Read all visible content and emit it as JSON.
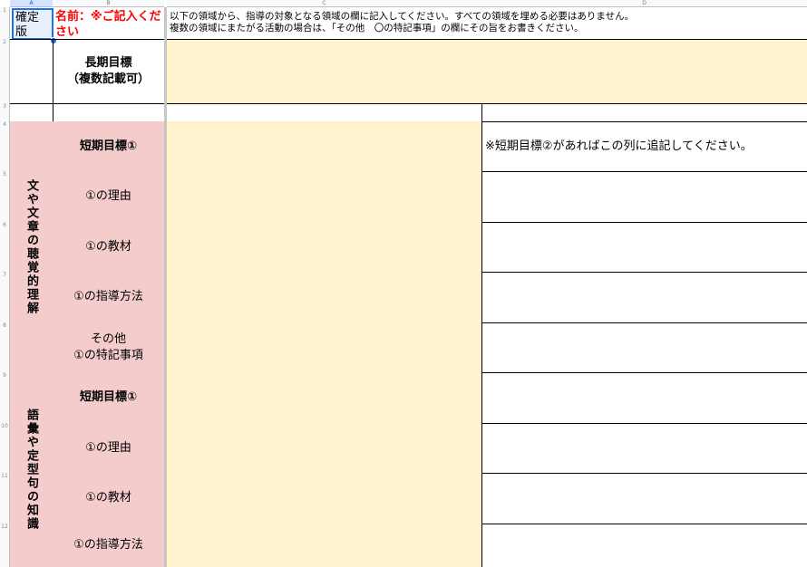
{
  "columns": {
    "a": "A",
    "b": "B",
    "c": "C",
    "d": "D"
  },
  "row_numbers": [
    "1",
    "2",
    "3",
    "4",
    "5",
    "6",
    "7",
    "8",
    "9",
    "10",
    "11",
    "12"
  ],
  "top": {
    "confirm_label": "確定版",
    "name_label": "名前：※ご記入ください",
    "instruction_line1": "以下の領域から、指導の対象となる領域の欄に記入してください。すべての領域を埋める必要はありません。",
    "instruction_line2": "複数の領域にまたがる活動の場合は、「その他　〇の特記事項」の欄にその旨をお書きください。"
  },
  "long_term": {
    "label_line1": "長期目標",
    "label_line2": "（複数記載可）"
  },
  "sections": [
    {
      "title": "文や文章の聴覚的理解",
      "rows": [
        {
          "label": "短期目標①",
          "bold": true
        },
        {
          "label": "①の理由"
        },
        {
          "label": "①の教材"
        },
        {
          "label": "①の指導方法"
        },
        {
          "label_line1": "その他",
          "label_line2": "①の特記事項"
        }
      ]
    },
    {
      "title": "語彙や定型句の知識",
      "rows": [
        {
          "label": "短期目標①",
          "bold": true
        },
        {
          "label": "①の理由"
        },
        {
          "label": "①の教材"
        },
        {
          "label": "①の指導方法"
        }
      ]
    }
  ],
  "hint": "※短期目標②があればこの列に追記してください。",
  "colors": {
    "pink": "#f4cccc",
    "yellow": "#fff2cc",
    "name_red": "#ff0000",
    "selection": "#1a73e8"
  }
}
